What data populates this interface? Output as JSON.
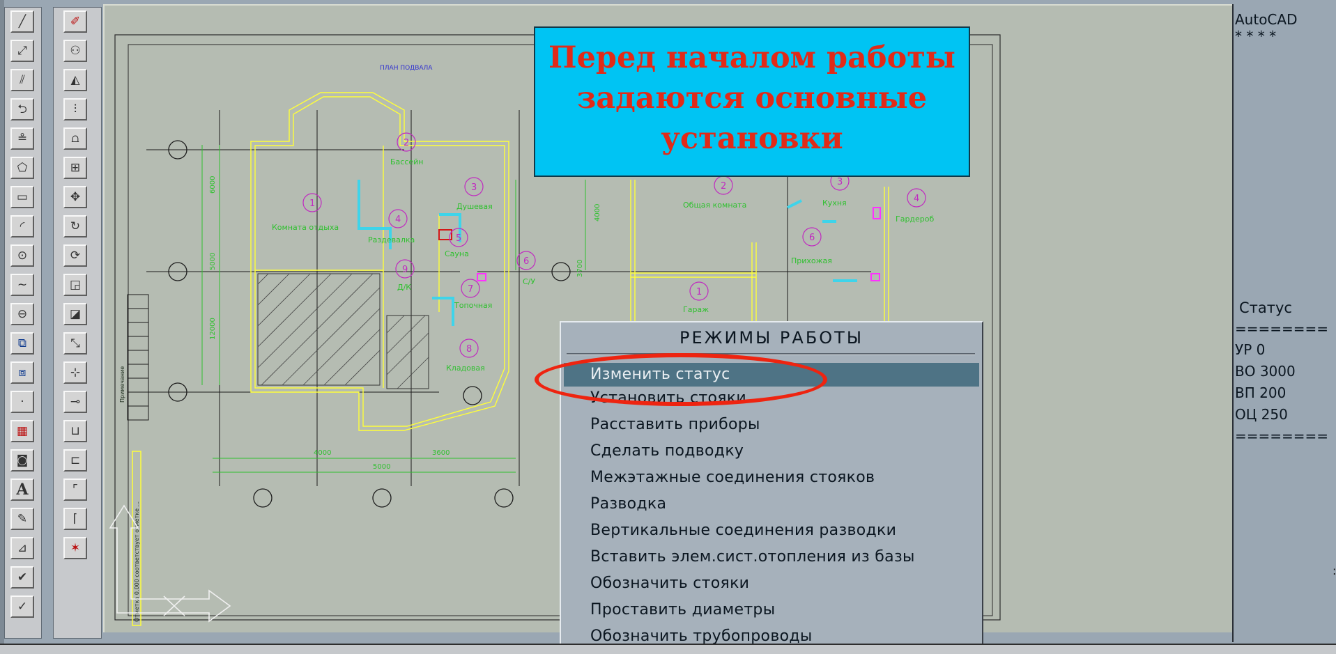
{
  "banner": {
    "lines": [
      "Перед началом работы",
      "задаются основные",
      "установки"
    ]
  },
  "colors": {
    "banner_bg": "#00c4f3",
    "banner_text": "#e12a18",
    "highlight_oval": "#ee2410",
    "menu_selected_bg": "#4e7385",
    "canvas_bg": "#b5bcb2",
    "plan_walls": "#ffff3a",
    "plan_dims": "#2fc02f",
    "plan_numbers": "#c02ac0",
    "plan_pipes": "#3ed4ea"
  },
  "toolbar_left": {
    "icons": [
      "line-icon",
      "construction-line-icon",
      "multiline-icon",
      "polyline-icon",
      "3d-polyline-icon",
      "polygon-icon",
      "rectangle-icon",
      "arc-icon",
      "circle-icon",
      "spline-icon",
      "ellipse-icon",
      "insert-block-icon",
      "make-block-icon",
      "point-icon",
      "hatch-icon",
      "region-icon",
      "text-icon",
      "edit-text-icon",
      "dimension-icon",
      "check-icon",
      "check-alt-icon"
    ]
  },
  "toolbar_right": {
    "icons": [
      "erase-icon",
      "copy-icon",
      "mirror-icon",
      "offset-icon",
      "array-icon",
      "array-grid-icon",
      "move-icon",
      "rotate-icon",
      "rotate-alt-icon",
      "scale-icon",
      "stretch-icon",
      "lengthen-icon",
      "trim-icon",
      "extend-icon",
      "break-icon",
      "break-at-point-icon",
      "chamfer-icon",
      "fillet-icon",
      "explode-icon"
    ]
  },
  "drawing": {
    "plan_title": "ПЛАН ПОДВАЛА",
    "rooms": [
      {
        "num": "1",
        "name": "Комната отдыха"
      },
      {
        "num": "2",
        "name": "Бассейн"
      },
      {
        "num": "3",
        "name": "Душевая"
      },
      {
        "num": "4",
        "name": "Раздевалка"
      },
      {
        "num": "5",
        "name": "Сауна"
      },
      {
        "num": "6",
        "name": "С/У"
      },
      {
        "num": "7",
        "name": "Топочная"
      },
      {
        "num": "8",
        "name": "Кладовая"
      },
      {
        "num": "9",
        "name": "Д/К"
      }
    ],
    "rooms_right": [
      {
        "num": "1",
        "name": "Гараж"
      },
      {
        "num": "2",
        "name": "Общая комната"
      },
      {
        "num": "3",
        "name": "Кухня"
      },
      {
        "num": "4",
        "name": "Гардероб"
      },
      {
        "num": "6",
        "name": "Прихожая"
      }
    ],
    "dims": {
      "d1": "6000",
      "d2": "5000",
      "d3": "12000",
      "d4": "4000",
      "d5": "3600",
      "d6": "5000",
      "d7": "4000",
      "d8": "3700"
    },
    "vertical_note": "Отметка 0.000 соответствует отметке ...",
    "side_label": "Примечание"
  },
  "panel": {
    "app_name": "AutoCAD",
    "stars": "* * * *",
    "status_title": "Статус",
    "divider": "========",
    "status_lines": [
      "УР 0",
      "ВО 3000",
      "ВП 200",
      "ОЦ 250"
    ]
  },
  "menu": {
    "title": "РЕЖИМЫ РАБОТЫ",
    "items": [
      "Изменить статус",
      "Установить стояки",
      "Расставить приборы",
      "Сделать подводку",
      "Межэтажные соединения стояков",
      "Разводка",
      "Вертикальные соединения разводки",
      "Вставить элем.сист.отопления из базы",
      "Обозначить стояки",
      "Проставить диаметры",
      "Обозначить трубопроводы"
    ],
    "selected_index": 0
  },
  "edge_mark": ":"
}
